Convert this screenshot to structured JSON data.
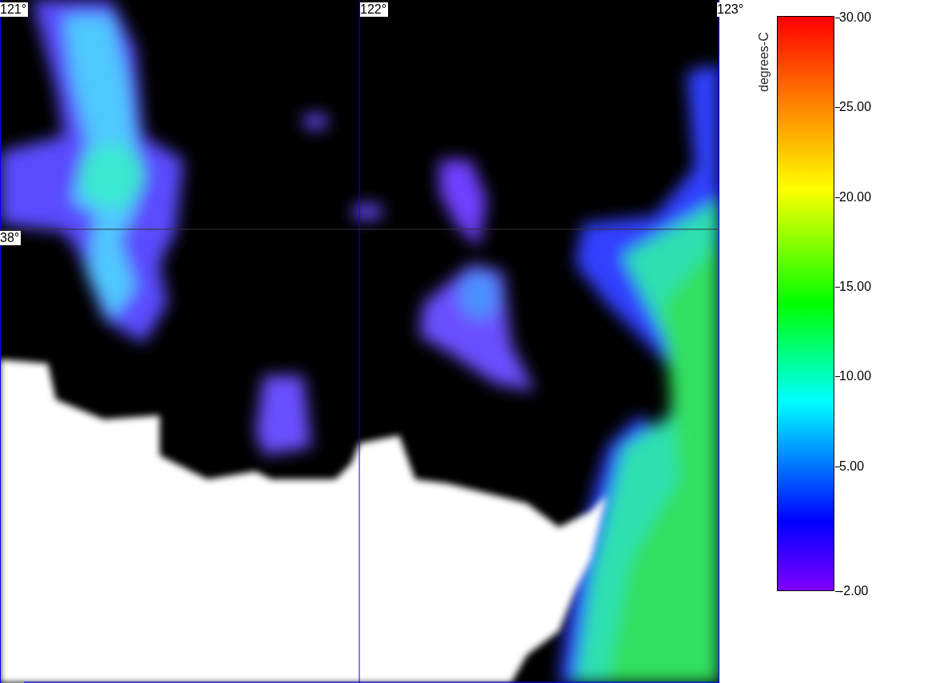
{
  "map": {
    "longitude_labels": [
      "121°",
      "122°",
      "123°"
    ],
    "latitude_labels": [
      "38°"
    ]
  },
  "colorbar": {
    "label": "degrees-C",
    "ticks": [
      "30.00",
      "25.00",
      "20.00",
      "15.00",
      "10.00",
      "5.00",
      "-2.00"
    ]
  }
}
